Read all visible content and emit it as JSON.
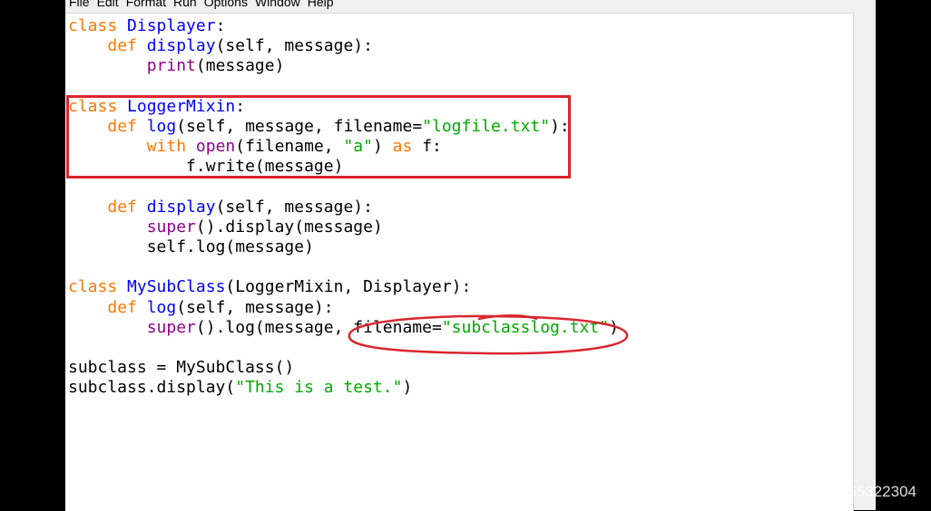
{
  "menu": [
    "File",
    "Edit",
    "Format",
    "Run",
    "Options",
    "Window",
    "Help"
  ],
  "code_lines": [
    [
      {
        "t": "class ",
        "c": "kw"
      },
      {
        "t": "Displayer",
        "c": "def"
      },
      {
        "t": ":",
        "c": "plain"
      }
    ],
    [
      {
        "t": "    ",
        "c": "plain"
      },
      {
        "t": "def ",
        "c": "kw"
      },
      {
        "t": "display",
        "c": "def"
      },
      {
        "t": "(self, message):",
        "c": "plain"
      }
    ],
    [
      {
        "t": "        ",
        "c": "plain"
      },
      {
        "t": "print",
        "c": "bi"
      },
      {
        "t": "(message)",
        "c": "plain"
      }
    ],
    [],
    [
      {
        "t": "class ",
        "c": "kw"
      },
      {
        "t": "LoggerMixin",
        "c": "def"
      },
      {
        "t": ":",
        "c": "plain"
      }
    ],
    [
      {
        "t": "    ",
        "c": "plain"
      },
      {
        "t": "def ",
        "c": "kw"
      },
      {
        "t": "log",
        "c": "def"
      },
      {
        "t": "(self, message, filename=",
        "c": "plain"
      },
      {
        "t": "\"logfile.txt\"",
        "c": "str"
      },
      {
        "t": "):",
        "c": "plain"
      }
    ],
    [
      {
        "t": "        ",
        "c": "plain"
      },
      {
        "t": "with ",
        "c": "kw"
      },
      {
        "t": "open",
        "c": "bi"
      },
      {
        "t": "(filename, ",
        "c": "plain"
      },
      {
        "t": "\"a\"",
        "c": "str"
      },
      {
        "t": ") ",
        "c": "plain"
      },
      {
        "t": "as",
        "c": "kw"
      },
      {
        "t": " f:",
        "c": "plain"
      }
    ],
    [
      {
        "t": "            f.write(message)",
        "c": "plain"
      }
    ],
    [],
    [
      {
        "t": "    ",
        "c": "plain"
      },
      {
        "t": "def ",
        "c": "kw"
      },
      {
        "t": "display",
        "c": "def"
      },
      {
        "t": "(self, message):",
        "c": "plain"
      }
    ],
    [
      {
        "t": "        ",
        "c": "plain"
      },
      {
        "t": "super",
        "c": "bi"
      },
      {
        "t": "().display(message)",
        "c": "plain"
      }
    ],
    [
      {
        "t": "        self.log(message)",
        "c": "plain"
      }
    ],
    [],
    [
      {
        "t": "class ",
        "c": "kw"
      },
      {
        "t": "MySubClass",
        "c": "def"
      },
      {
        "t": "(LoggerMixin, Displayer):",
        "c": "plain"
      }
    ],
    [
      {
        "t": "    ",
        "c": "plain"
      },
      {
        "t": "def ",
        "c": "kw"
      },
      {
        "t": "log",
        "c": "def"
      },
      {
        "t": "(self, message):",
        "c": "plain"
      }
    ],
    [
      {
        "t": "        ",
        "c": "plain"
      },
      {
        "t": "super",
        "c": "bi"
      },
      {
        "t": "().log(message, filename=",
        "c": "plain"
      },
      {
        "t": "\"subclasslog.txt\"",
        "c": "str"
      },
      {
        "t": ")",
        "c": "plain"
      }
    ],
    [],
    [
      {
        "t": "subclass = MySubClass()",
        "c": "plain"
      }
    ],
    [
      {
        "t": "subclass.display(",
        "c": "plain"
      },
      {
        "t": "\"This is a test.\"",
        "c": "str"
      },
      {
        "t": ")",
        "c": "plain"
      }
    ]
  ],
  "colors": {
    "keyword": "#ff7700",
    "definition": "#0000ff",
    "builtin": "#900090",
    "string": "#00aa00",
    "annotation_red": "#d9262c"
  },
  "watermark": "CSDN @weixin_55322304"
}
